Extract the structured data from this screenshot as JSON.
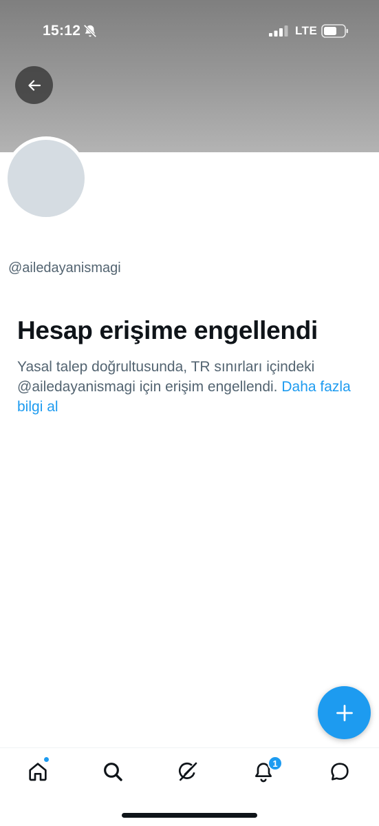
{
  "status_bar": {
    "time": "15:12",
    "network": "LTE"
  },
  "profile": {
    "handle": "@ailedayanismagi"
  },
  "blocked_notice": {
    "title": "Hesap erişime engellendi",
    "description": "Yasal talep doğrultusunda, TR sınırları içindeki @ailedayanismagi için erişim engellendi.",
    "learn_more": "Daha fazla bilgi al"
  },
  "tab_bar": {
    "notification_count": "1"
  },
  "icons": {
    "back": "arrow-left-icon",
    "compose": "plus-icon",
    "home": "home-icon",
    "search": "search-icon",
    "grok": "grok-icon",
    "notifications": "bell-icon",
    "messages": "chat-bubble-icon"
  },
  "colors": {
    "accent": "#1d9bf0",
    "text_primary": "#0f1419",
    "text_secondary": "#536471",
    "avatar_placeholder": "#d5dce2"
  }
}
